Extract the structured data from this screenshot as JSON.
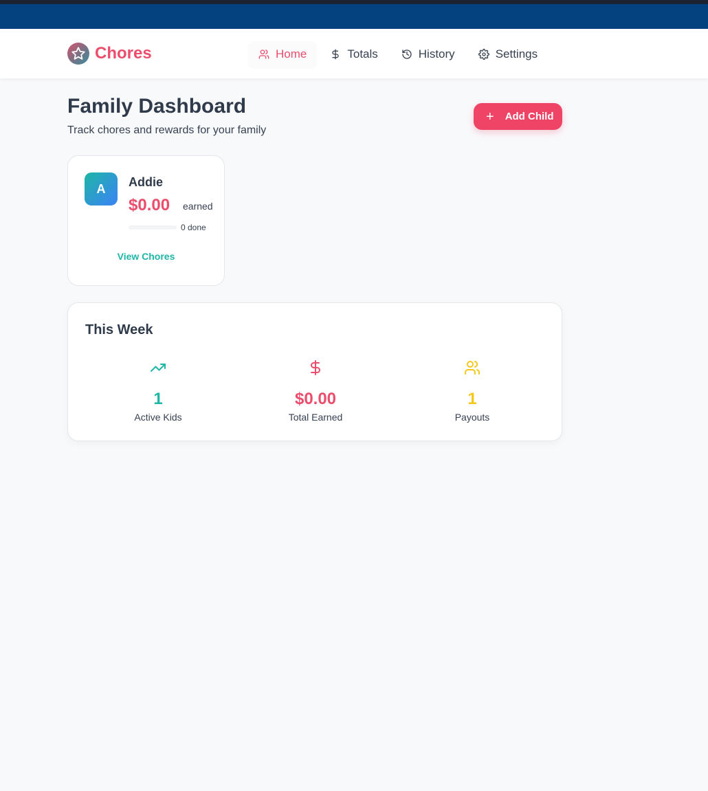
{
  "brand": {
    "name": "Chores",
    "logo_icon": "star-icon"
  },
  "nav": {
    "items": [
      {
        "label": "Home",
        "icon": "users-icon",
        "active": true
      },
      {
        "label": "Totals",
        "icon": "dollar-icon",
        "active": false
      },
      {
        "label": "History",
        "icon": "history-icon",
        "active": false
      },
      {
        "label": "Settings",
        "icon": "gear-icon",
        "active": false
      }
    ]
  },
  "header": {
    "title": "Family Dashboard",
    "subtitle": "Track chores and rewards for your family",
    "add_button_label": "Add Child"
  },
  "children": [
    {
      "initial": "A",
      "name": "Addie",
      "amount": "$0.00",
      "earned_label": "earned",
      "progress": 0,
      "done_text": "0 done",
      "view_label": "View Chores"
    }
  ],
  "week": {
    "title": "This Week",
    "stats": [
      {
        "value": "1",
        "label": "Active Kids",
        "icon": "trending-up-icon",
        "color": "#1eb6a5"
      },
      {
        "value": "$0.00",
        "label": "Total Earned",
        "icon": "dollar-icon",
        "color": "#ec4d6c"
      },
      {
        "value": "1",
        "label": "Payouts",
        "icon": "users-icon",
        "color": "#f4c818"
      }
    ]
  },
  "colors": {
    "accent": "#ec4d6c",
    "button": "#ef4466",
    "teal": "#1eb6a5",
    "yellow": "#f4c818",
    "browser_band": "#03417f"
  }
}
